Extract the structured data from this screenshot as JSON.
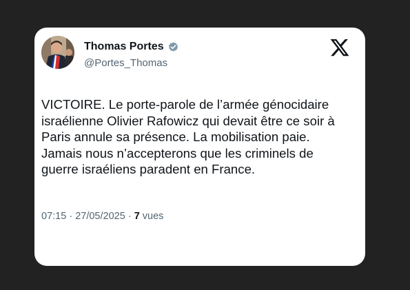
{
  "author": {
    "name": "Thomas Portes",
    "handle": "@Portes_Thomas",
    "verified_icon": "verified-badge-icon"
  },
  "platform_icon": "x-logo-icon",
  "colors": {
    "background": "#222222",
    "card": "#ffffff",
    "text": "#0f1419",
    "secondary": "#536471",
    "verified_badge": "#829aab"
  },
  "tweet": {
    "lines": [
      "VICTOIRE. Le porte-parole de l’armée génocidaire",
      "israélienne Olivier Rafowicz qui devait être ce soir à",
      "Paris annule sa présence. La mobilisation paie.",
      "Jamais nous n’accepterons que les criminels de",
      "guerre israéliens paradent en France."
    ]
  },
  "meta": {
    "time": "07:15",
    "separator": "·",
    "date": "27/05/2025",
    "views_count": "7",
    "views_label": "vues"
  }
}
